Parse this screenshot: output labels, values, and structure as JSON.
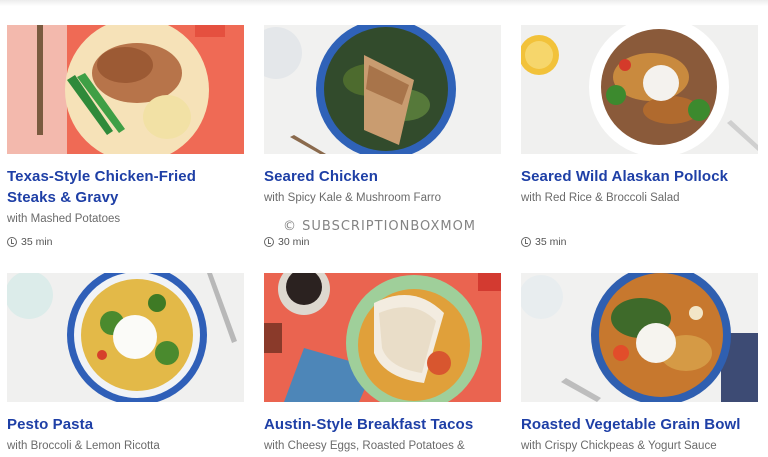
{
  "watermark": "© SUBSCRIPTIONBOXMOM",
  "recipes": [
    {
      "title": "Texas-Style Chicken-Fried Steaks & Gravy",
      "subtitle": "with Mashed Potatoes",
      "time": "35 min"
    },
    {
      "title": "Seared Chicken",
      "subtitle": "with Spicy Kale & Mushroom Farro",
      "time": "30 min"
    },
    {
      "title": "Seared Wild Alaskan Pollock",
      "subtitle": "with Red Rice & Broccoli Salad",
      "time": "35 min"
    },
    {
      "title": "Pesto Pasta",
      "subtitle": "with Broccoli & Lemon Ricotta"
    },
    {
      "title": "Austin-Style Breakfast Tacos",
      "subtitle": "with Cheesy Eggs, Roasted Potatoes &"
    },
    {
      "title": "Roasted Vegetable Grain Bowl",
      "subtitle": "with Crispy Chickpeas & Yogurt Sauce"
    }
  ],
  "colors": {
    "title": "#1e3fa6",
    "subtitle": "#6b6b6b"
  }
}
